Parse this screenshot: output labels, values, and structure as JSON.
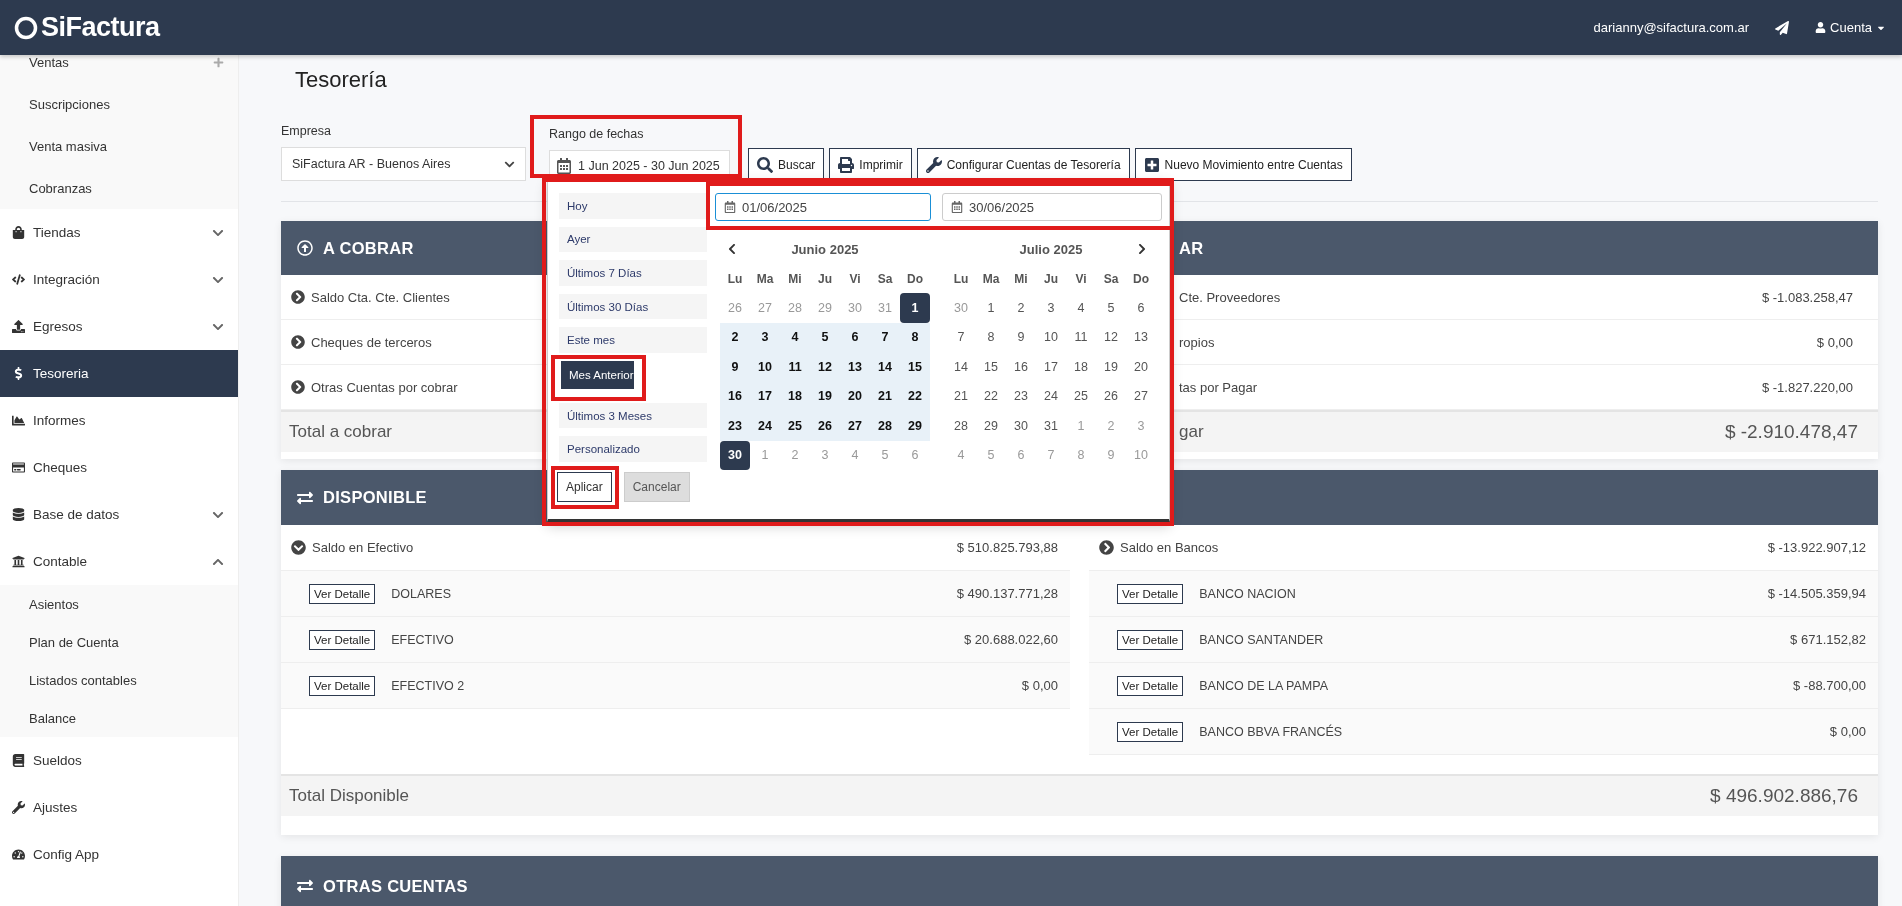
{
  "navbar": {
    "logo": "SiFactura",
    "user_email": "darianny@sifactura.com.ar",
    "account_menu": "Cuenta"
  },
  "sidebar": {
    "items": [
      {
        "label": "Ventas",
        "kind": "subitem"
      },
      {
        "label": "Suscripciones",
        "kind": "subitem"
      },
      {
        "label": "Venta masiva",
        "kind": "subitem"
      },
      {
        "label": "Cobranzas",
        "kind": "subitem"
      },
      {
        "label": "Tiendas",
        "kind": "item",
        "selected": false,
        "expanded": false
      },
      {
        "label": "Integración",
        "kind": "item",
        "selected": false,
        "expanded": false
      },
      {
        "label": "Egresos",
        "kind": "item",
        "selected": false,
        "expanded": false
      },
      {
        "label": "Tesoreria",
        "kind": "item",
        "selected": true
      },
      {
        "label": "Informes",
        "kind": "item",
        "selected": false
      },
      {
        "label": "Cheques",
        "kind": "item",
        "selected": false
      },
      {
        "label": "Base de datos",
        "kind": "item",
        "selected": false,
        "expanded": false
      },
      {
        "label": "Contable",
        "kind": "item",
        "selected": false,
        "expanded": true,
        "children": [
          {
            "label": "Asientos"
          },
          {
            "label": "Plan de Cuenta"
          },
          {
            "label": "Listados contables"
          },
          {
            "label": "Balance"
          }
        ]
      },
      {
        "label": "Sueldos",
        "kind": "item",
        "selected": false
      },
      {
        "label": "Ajustes",
        "kind": "item",
        "selected": false
      },
      {
        "label": "Config App",
        "kind": "item",
        "selected": false
      }
    ]
  },
  "title": "Tesorería",
  "filters": {
    "company": {
      "label": "Empresa",
      "value": "SiFactura AR - Buenos Aires"
    },
    "date_range": {
      "label": "Rango de fechas",
      "value": "1 Jun 2025 - 30 Jun 2025"
    }
  },
  "buttons": [
    "Buscar",
    "Imprimir",
    "Configurar Cuentas de Tesorería",
    "Nuevo Movimiento entre Cuentas"
  ],
  "date_picker": {
    "ranges": [
      {
        "label": "Hoy",
        "selected": false
      },
      {
        "label": "Ayer",
        "selected": false
      },
      {
        "label": "Últimos 7 Días",
        "selected": false
      },
      {
        "label": "Últimos 30 Días",
        "selected": false
      },
      {
        "label": "Este mes",
        "selected": false
      },
      {
        "label": "Mes Anterior",
        "selected": true
      },
      {
        "label": "Últimos 3 Meses",
        "selected": false
      },
      {
        "label": "Personalizado",
        "selected": false
      }
    ],
    "inputs": [
      {
        "value": "01/06/2025",
        "focused": true
      },
      {
        "value": "30/06/2025",
        "focused": false
      }
    ],
    "months": [
      {
        "title": "Junio 2025",
        "weekdays": [
          "Lu",
          "Ma",
          "Mi",
          "Ju",
          "Vi",
          "Sa",
          "Do"
        ],
        "weeks": [
          [
            {
              "day": "26",
              "outside": true,
              "selected": false,
              "in_range": false
            },
            {
              "day": "27",
              "outside": true,
              "selected": false,
              "in_range": false
            },
            {
              "day": "28",
              "outside": true,
              "selected": false,
              "in_range": false
            },
            {
              "day": "29",
              "outside": true,
              "selected": false,
              "in_range": false
            },
            {
              "day": "30",
              "outside": true,
              "selected": false,
              "in_range": false
            },
            {
              "day": "31",
              "outside": true,
              "selected": false,
              "in_range": false
            },
            {
              "day": "1",
              "outside": false,
              "selected": true,
              "in_range": true
            }
          ],
          [
            {
              "day": "2",
              "outside": false,
              "selected": false,
              "in_range": true
            },
            {
              "day": "3",
              "outside": false,
              "selected": false,
              "in_range": true
            },
            {
              "day": "4",
              "outside": false,
              "selected": false,
              "in_range": true
            },
            {
              "day": "5",
              "outside": false,
              "selected": false,
              "in_range": true
            },
            {
              "day": "6",
              "outside": false,
              "selected": false,
              "in_range": true
            },
            {
              "day": "7",
              "outside": false,
              "selected": false,
              "in_range": true
            },
            {
              "day": "8",
              "outside": false,
              "selected": false,
              "in_range": true
            }
          ],
          [
            {
              "day": "9",
              "outside": false,
              "selected": false,
              "in_range": true
            },
            {
              "day": "10",
              "outside": false,
              "selected": false,
              "in_range": true
            },
            {
              "day": "11",
              "outside": false,
              "selected": false,
              "in_range": true
            },
            {
              "day": "12",
              "outside": false,
              "selected": false,
              "in_range": true
            },
            {
              "day": "13",
              "outside": false,
              "selected": false,
              "in_range": true
            },
            {
              "day": "14",
              "outside": false,
              "selected": false,
              "in_range": true
            },
            {
              "day": "15",
              "outside": false,
              "selected": false,
              "in_range": true
            }
          ],
          [
            {
              "day": "16",
              "outside": false,
              "selected": false,
              "in_range": true
            },
            {
              "day": "17",
              "outside": false,
              "selected": false,
              "in_range": true
            },
            {
              "day": "18",
              "outside": false,
              "selected": false,
              "in_range": true
            },
            {
              "day": "19",
              "outside": false,
              "selected": false,
              "in_range": true
            },
            {
              "day": "20",
              "outside": false,
              "selected": false,
              "in_range": true
            },
            {
              "day": "21",
              "outside": false,
              "selected": false,
              "in_range": true
            },
            {
              "day": "22",
              "outside": false,
              "selected": false,
              "in_range": true
            }
          ],
          [
            {
              "day": "23",
              "outside": false,
              "selected": false,
              "in_range": true
            },
            {
              "day": "24",
              "outside": false,
              "selected": false,
              "in_range": true
            },
            {
              "day": "25",
              "outside": false,
              "selected": false,
              "in_range": true
            },
            {
              "day": "26",
              "outside": false,
              "selected": false,
              "in_range": true
            },
            {
              "day": "27",
              "outside": false,
              "selected": false,
              "in_range": true
            },
            {
              "day": "28",
              "outside": false,
              "selected": false,
              "in_range": true
            },
            {
              "day": "29",
              "outside": false,
              "selected": false,
              "in_range": true
            }
          ],
          [
            {
              "day": "30",
              "outside": false,
              "selected": true,
              "in_range": true
            },
            {
              "day": "1",
              "outside": true,
              "selected": false,
              "in_range": false
            },
            {
              "day": "2",
              "outside": true,
              "selected": false,
              "in_range": false
            },
            {
              "day": "3",
              "outside": true,
              "selected": false,
              "in_range": false
            },
            {
              "day": "4",
              "outside": true,
              "selected": false,
              "in_range": false
            },
            {
              "day": "5",
              "outside": true,
              "selected": false,
              "in_range": false
            },
            {
              "day": "6",
              "outside": true,
              "selected": false,
              "in_range": false
            }
          ]
        ]
      },
      {
        "title": "Julio 2025",
        "weekdays": [
          "Lu",
          "Ma",
          "Mi",
          "Ju",
          "Vi",
          "Sa",
          "Do"
        ],
        "weeks": [
          [
            {
              "day": "30",
              "outside": true,
              "selected": false,
              "in_range": false
            },
            {
              "day": "1",
              "outside": false,
              "selected": false,
              "in_range": false
            },
            {
              "day": "2",
              "outside": false,
              "selected": false,
              "in_range": false
            },
            {
              "day": "3",
              "outside": false,
              "selected": false,
              "in_range": false
            },
            {
              "day": "4",
              "outside": false,
              "selected": false,
              "in_range": false
            },
            {
              "day": "5",
              "outside": false,
              "selected": false,
              "in_range": false
            },
            {
              "day": "6",
              "outside": false,
              "selected": false,
              "in_range": false
            }
          ],
          [
            {
              "day": "7",
              "outside": false,
              "selected": false,
              "in_range": false
            },
            {
              "day": "8",
              "outside": false,
              "selected": false,
              "in_range": false
            },
            {
              "day": "9",
              "outside": false,
              "selected": false,
              "in_range": false
            },
            {
              "day": "10",
              "outside": false,
              "selected": false,
              "in_range": false
            },
            {
              "day": "11",
              "outside": false,
              "selected": false,
              "in_range": false
            },
            {
              "day": "12",
              "outside": false,
              "selected": false,
              "in_range": false
            },
            {
              "day": "13",
              "outside": false,
              "selected": false,
              "in_range": false
            }
          ],
          [
            {
              "day": "14",
              "outside": false,
              "selected": false,
              "in_range": false
            },
            {
              "day": "15",
              "outside": false,
              "selected": false,
              "in_range": false
            },
            {
              "day": "16",
              "outside": false,
              "selected": false,
              "in_range": false
            },
            {
              "day": "17",
              "outside": false,
              "selected": false,
              "in_range": false
            },
            {
              "day": "18",
              "outside": false,
              "selected": false,
              "in_range": false
            },
            {
              "day": "19",
              "outside": false,
              "selected": false,
              "in_range": false
            },
            {
              "day": "20",
              "outside": false,
              "selected": false,
              "in_range": false
            }
          ],
          [
            {
              "day": "21",
              "outside": false,
              "selected": false,
              "in_range": false
            },
            {
              "day": "22",
              "outside": false,
              "selected": false,
              "in_range": false
            },
            {
              "day": "23",
              "outside": false,
              "selected": false,
              "in_range": false
            },
            {
              "day": "24",
              "outside": false,
              "selected": false,
              "in_range": false
            },
            {
              "day": "25",
              "outside": false,
              "selected": false,
              "in_range": false
            },
            {
              "day": "26",
              "outside": false,
              "selected": false,
              "in_range": false
            },
            {
              "day": "27",
              "outside": false,
              "selected": false,
              "in_range": false
            }
          ],
          [
            {
              "day": "28",
              "outside": false,
              "selected": false,
              "in_range": false
            },
            {
              "day": "29",
              "outside": false,
              "selected": false,
              "in_range": false
            },
            {
              "day": "30",
              "outside": false,
              "selected": false,
              "in_range": false
            },
            {
              "day": "31",
              "outside": false,
              "selected": false,
              "in_range": false
            },
            {
              "day": "1",
              "outside": true,
              "selected": false,
              "in_range": false
            },
            {
              "day": "2",
              "outside": true,
              "selected": false,
              "in_range": false
            },
            {
              "day": "3",
              "outside": true,
              "selected": false,
              "in_range": false
            }
          ],
          [
            {
              "day": "4",
              "outside": true,
              "selected": false,
              "in_range": false
            },
            {
              "day": "5",
              "outside": true,
              "selected": false,
              "in_range": false
            },
            {
              "day": "6",
              "outside": true,
              "selected": false,
              "in_range": false
            },
            {
              "day": "7",
              "outside": true,
              "selected": false,
              "in_range": false
            },
            {
              "day": "8",
              "outside": true,
              "selected": false,
              "in_range": false
            },
            {
              "day": "9",
              "outside": true,
              "selected": false,
              "in_range": false
            },
            {
              "day": "10",
              "outside": true,
              "selected": false,
              "in_range": false
            }
          ]
        ]
      }
    ],
    "apply": "Aplicar",
    "cancel": "Cancelar"
  },
  "a_cobrar": {
    "title": "A COBRAR",
    "rows": [
      {
        "label": "Saldo Cta. Cte. Clientes"
      },
      {
        "label": "Cheques de terceros"
      },
      {
        "label": "Otras Cuentas por cobrar"
      }
    ],
    "total_label": "Total a cobrar"
  },
  "a_pagar": {
    "title": "AR",
    "rows": [
      {
        "label": "Cte. Proveedores",
        "amount": "$ -1.083.258,47"
      },
      {
        "label": "ropios",
        "amount": "$ 0,00"
      },
      {
        "label": "tas por Pagar",
        "amount": "$ -1.827.220,00"
      }
    ],
    "total_label": "gar",
    "total": "$ -2.910.478,47"
  },
  "disponible": {
    "title": "DISPONIBLE",
    "columns": [
      {
        "label": "Saldo en Efectivo",
        "amount": "$ 510.825.793,88",
        "expanded": true,
        "accounts": [
          {
            "button": "Ver Detalle",
            "name": "DOLARES",
            "amount": "$ 490.137.771,28"
          },
          {
            "button": "Ver Detalle",
            "name": "EFECTIVO",
            "amount": "$ 20.688.022,60"
          },
          {
            "button": "Ver Detalle",
            "name": "EFECTIVO 2",
            "amount": "$ 0,00"
          }
        ]
      },
      {
        "label": "Saldo en Bancos",
        "amount": "$ -13.922.907,12",
        "expanded": false,
        "accounts": [
          {
            "button": "Ver Detalle",
            "name": "BANCO NACION",
            "amount": "$ -14.505.359,94"
          },
          {
            "button": "Ver Detalle",
            "name": "BANCO SANTANDER",
            "amount": "$ 671.152,82"
          },
          {
            "button": "Ver Detalle",
            "name": "BANCO DE LA PAMPA",
            "amount": "$ -88.700,00"
          },
          {
            "button": "Ver Detalle",
            "name": "BANCO BBVA FRANCÉS",
            "amount": "$ 0,00"
          }
        ]
      }
    ],
    "total_label": "Total Disponible",
    "total": "$ 496.902.886,76"
  },
  "otras_cuentas": {
    "title": "OTRAS CUENTAS"
  }
}
